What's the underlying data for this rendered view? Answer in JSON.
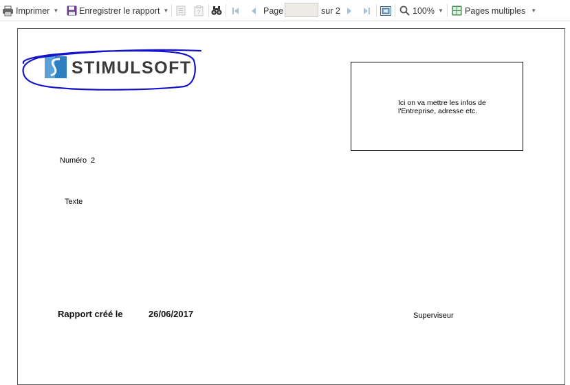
{
  "toolbar": {
    "print_label": "Imprimer",
    "save_label": "Enregistrer le rapport",
    "page_label": "Page",
    "page_value": "",
    "page_total": "sur 2",
    "zoom_label": "100%",
    "view_mode_label": "Pages multiples"
  },
  "report": {
    "logo_text": "STIMULSOFT",
    "company_info_line1": "Ici on va mettre les infos de",
    "company_info_line2": "l'Entreprise, adresse etc.",
    "number_label": "Numéro",
    "number_value": "2",
    "text_label": "Texte",
    "created_label": "Rapport créé le",
    "created_date": "26/06/2017",
    "supervisor_label": "Superviseur"
  },
  "colors": {
    "logo_blue": "#2e7fc0",
    "logo_text": "#3a3a3a",
    "annotation_stroke": "#1414c8"
  }
}
